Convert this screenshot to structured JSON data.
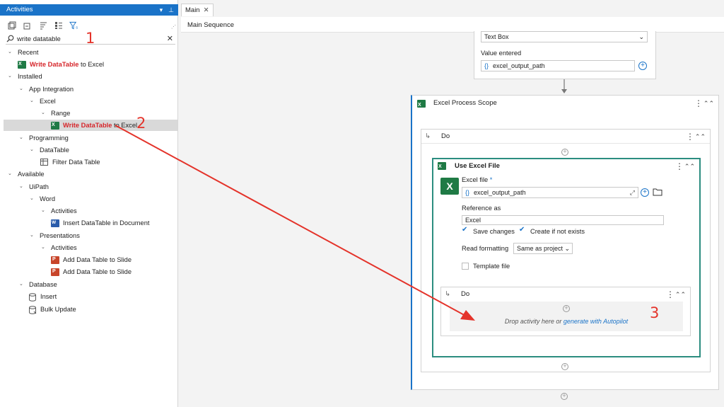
{
  "panel": {
    "title": "Activities",
    "pin_icon": "pin-icon",
    "search_value": "write datatable"
  },
  "tree": {
    "recent": "Recent",
    "recent_item_hl": "Write DataTable",
    "recent_item_rest": " to Excel",
    "installed": "Installed",
    "app_integration": "App Integration",
    "excel": "Excel",
    "range": "Range",
    "sel_item_hl": "Write DataTable",
    "sel_item_rest": " to Excel",
    "programming": "Programming",
    "datatable": "DataTable",
    "filter_data_table": "Filter Data Table",
    "available": "Available",
    "uipath": "UiPath",
    "word": "Word",
    "word_activities": "Activities",
    "insert_dt_doc": "Insert DataTable in Document",
    "presentations": "Presentations",
    "pres_activities": "Activities",
    "add_dt_slide_1": "Add Data Table to Slide",
    "add_dt_slide_2": "Add Data Table to Slide",
    "database": "Database",
    "insert": "Insert",
    "bulk_update": "Bulk Update"
  },
  "annotations": {
    "n1": "1",
    "n2": "2",
    "n3": "3"
  },
  "designer": {
    "tab_label": "Main",
    "breadcrumb": "Main Sequence",
    "textbox_dropdown": "Text Box",
    "value_entered_label": "Value entered",
    "value_entered": "excel_output_path",
    "scope_title": "Excel Process Scope",
    "do_label_outer": "Do",
    "use_excel_title": "Use Excel File",
    "excel_file_label": "Excel file",
    "excel_file_required": "*",
    "excel_file_value": "excel_output_path",
    "reference_as_label": "Reference as",
    "reference_as_value": "Excel",
    "save_changes": "Save changes",
    "create_if_not_exists": "Create if not exists",
    "read_formatting_label": "Read formatting",
    "read_formatting_value": "Same as project",
    "template_file": "Template file",
    "do_label_inner": "Do",
    "drop_text": "Drop activity here or ",
    "drop_link": "generate with Autopilot"
  },
  "colors": {
    "accent": "#1a73c8",
    "highlight": "#d6252a",
    "annotation": "#e4332a",
    "teal_border": "#2c8d80"
  }
}
